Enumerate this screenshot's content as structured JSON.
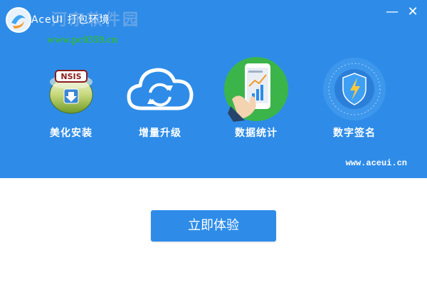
{
  "window": {
    "title": "AceUI 打包环境",
    "minimize_glyph": "—",
    "close_glyph": "✕"
  },
  "watermark": {
    "site_name": "河东软件园",
    "url": "www.pc0359.cn"
  },
  "features": [
    {
      "label": "美化安装",
      "icon": "nsis-installer-icon",
      "badge": "NSIS"
    },
    {
      "label": "增量升级",
      "icon": "cloud-sync-icon"
    },
    {
      "label": "数据统计",
      "icon": "phone-chart-icon"
    },
    {
      "label": "数字签名",
      "icon": "shield-lightning-icon"
    }
  ],
  "footer_link": "www.aceui.cn",
  "cta_label": "立即体验",
  "colors": {
    "brand_blue": "#2e8ce8",
    "white": "#ffffff",
    "green_circle": "#3bb54a",
    "watermark_green": "#2fb544"
  }
}
